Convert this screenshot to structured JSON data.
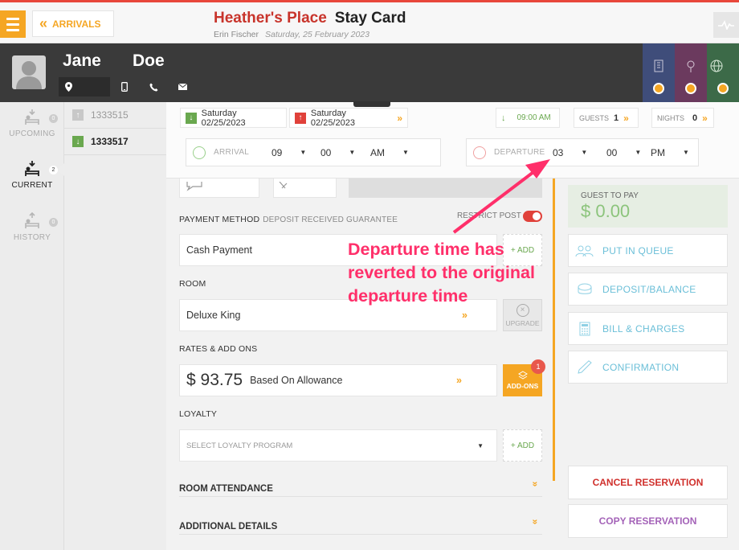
{
  "header": {
    "back_label": "ARRIVALS",
    "place_name": "Heather's Place",
    "title": "Stay Card",
    "user": "Erin Fischer",
    "date": "Saturday, 25 February 2023"
  },
  "guest": {
    "first_name": "Jane",
    "last_name": "Doe"
  },
  "sidebar": {
    "items": [
      {
        "label": "UPCOMING",
        "count": "0"
      },
      {
        "label": "CURRENT",
        "count": "2"
      },
      {
        "label": "HISTORY",
        "count": "0"
      }
    ]
  },
  "reservations": [
    {
      "number": "1333515",
      "state": "muted"
    },
    {
      "number": "1333517",
      "state": "selected"
    }
  ],
  "dates": {
    "arrival_date": "Saturday 02/25/2023",
    "departure_date": "Saturday 02/25/2023",
    "eta": "09:00 AM",
    "guests_label": "GUESTS",
    "guests_value": "1",
    "nights_label": "NIGHTS",
    "nights_value": "0",
    "arrival_label": "ARRIVAL",
    "arrival_hour": "09",
    "arrival_minute": "00",
    "arrival_ampm": "AM",
    "departure_label": "DEPARTURE",
    "departure_hour": "03",
    "departure_minute": "00",
    "departure_ampm": "PM"
  },
  "payment": {
    "label": "PAYMENT METHOD",
    "sub_label": "DEPOSIT RECEIVED GUARANTEE",
    "restrict_label": "RESTRICT POST",
    "value": "Cash Payment",
    "add_label": "+ ADD"
  },
  "room": {
    "label": "ROOM",
    "value": "Deluxe King",
    "upgrade_label": "UPGRADE"
  },
  "rates": {
    "label": "RATES & ADD ONS",
    "amount": "$ 93.75",
    "basis": "Based On Allowance",
    "addons_label": "ADD-ONS",
    "addons_count": "1"
  },
  "loyalty": {
    "label": "LOYALTY",
    "placeholder": "SELECT LOYALTY PROGRAM",
    "add_label": "+ ADD"
  },
  "sections": {
    "room_attendance": "ROOM ATTENDANCE",
    "additional_details": "ADDITIONAL DETAILS"
  },
  "right": {
    "pay_label": "GUEST TO PAY",
    "pay_amount": "$ 0.00",
    "actions": [
      "PUT IN QUEUE",
      "DEPOSIT/BALANCE",
      "BILL & CHARGES",
      "CONFIRMATION"
    ],
    "cancel_label": "CANCEL RESERVATION",
    "copy_label": "COPY RESERVATION"
  },
  "annotation": {
    "line1": "Departure time has",
    "line2": "reverted to the original",
    "line3": "departure time"
  },
  "colors": {
    "accent": "#f5a623",
    "brand_red": "#c8342b",
    "annotation": "#ff2f6a",
    "action_text": "#6bbfd8",
    "cancel": "#d0312d",
    "copy": "#a463b8"
  },
  "icons": [
    "menu-icon",
    "chevrons-left-icon",
    "pulse-icon",
    "location-icon",
    "mobile-icon",
    "phone-icon",
    "mail-icon",
    "bell-icon",
    "clock-icon",
    "queue-icon",
    "deposit-icon",
    "calculator-icon",
    "pen-icon"
  ]
}
